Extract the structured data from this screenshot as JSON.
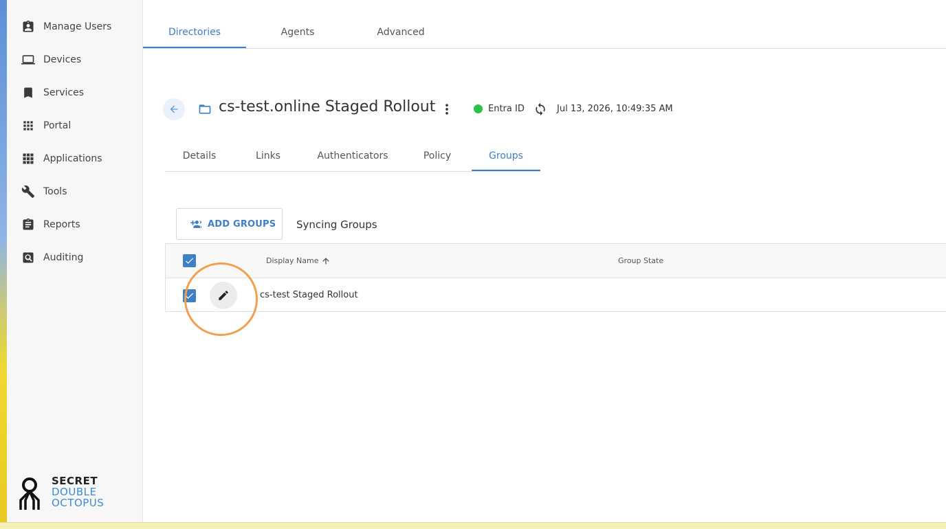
{
  "sidebar": {
    "items": [
      {
        "label": "Manage Users",
        "icon": "user-badge-icon"
      },
      {
        "label": "Devices",
        "icon": "laptop-icon"
      },
      {
        "label": "Services",
        "icon": "bookmark-icon"
      },
      {
        "label": "Portal",
        "icon": "grid-icon"
      },
      {
        "label": "Applications",
        "icon": "apps-icon"
      },
      {
        "label": "Tools",
        "icon": "wrench-icon"
      },
      {
        "label": "Reports",
        "icon": "clipboard-icon"
      },
      {
        "label": "Auditing",
        "icon": "search-box-icon"
      }
    ],
    "logo": {
      "line1": "SECRET",
      "line2": "DOUBLE",
      "line3": "OCTOPUS"
    }
  },
  "top_tabs": [
    {
      "label": "Directories",
      "active": true
    },
    {
      "label": "Agents",
      "active": false
    },
    {
      "label": "Advanced",
      "active": false
    }
  ],
  "header": {
    "title": "cs-test.online Staged Rollout",
    "provider": "Entra ID",
    "status_color": "#2fc24a",
    "timestamp": "Jul 13, 2026, 10:49:35 AM"
  },
  "sub_tabs": [
    {
      "label": "Details",
      "active": false
    },
    {
      "label": "Links",
      "active": false
    },
    {
      "label": "Authenticators",
      "active": false
    },
    {
      "label": "Policy",
      "active": false
    },
    {
      "label": "Groups",
      "active": true
    }
  ],
  "groups": {
    "add_button_label": "ADD GROUPS",
    "syncing_label": "Syncing Groups",
    "columns": {
      "display_name": "Display Name",
      "group_state": "Group State"
    },
    "rows": [
      {
        "display_name": "cs-test Staged Rollout",
        "group_state": "",
        "checked": true
      }
    ],
    "select_all_checked": true
  },
  "accent_color": "#3f7fc4"
}
